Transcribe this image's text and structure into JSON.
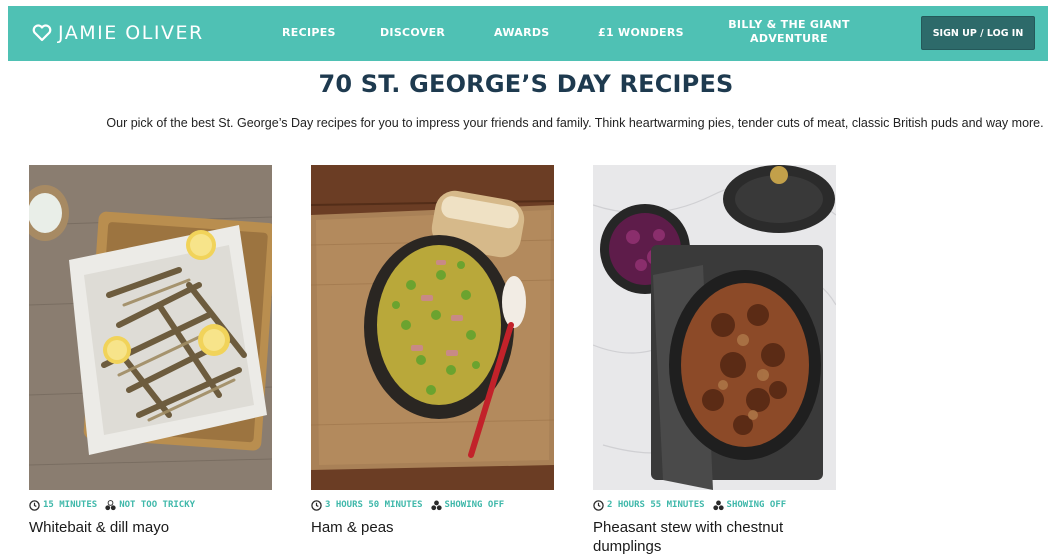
{
  "header": {
    "logo_text": "JAMIE OLIVER",
    "nav": [
      "RECIPES",
      "DISCOVER",
      "AWARDS",
      "£1 WONDERS"
    ],
    "nav_billy": "BILLY & THE GIANT ADVENTURE",
    "signup_label": "SIGN UP / LOG IN",
    "brand_color": "#4fc1b4",
    "button_color": "#2d6a6a"
  },
  "page": {
    "title": "70 ST. GEORGE’S DAY RECIPES",
    "subtitle": "Our pick of the best St. George’s Day recipes for you to impress your friends and family. Think heartwarming pies, tender cuts of meat, classic British puds and way more.",
    "accent_color": "#3fb8aa"
  },
  "recipes": [
    {
      "time": "15 MINUTES",
      "difficulty": "NOT TOO TRICKY",
      "title": "Whitebait & dill mayo"
    },
    {
      "time": "3 HOURS 50 MINUTES",
      "difficulty": "SHOWING OFF",
      "title": "Ham & peas"
    },
    {
      "time": "2 HOURS 55 MINUTES",
      "difficulty": "SHOWING OFF",
      "title": "Pheasant stew with chestnut dumplings"
    }
  ],
  "icons": {
    "logo": "heart-icon",
    "time": "clock-icon",
    "difficulty": "difficulty-icon"
  }
}
